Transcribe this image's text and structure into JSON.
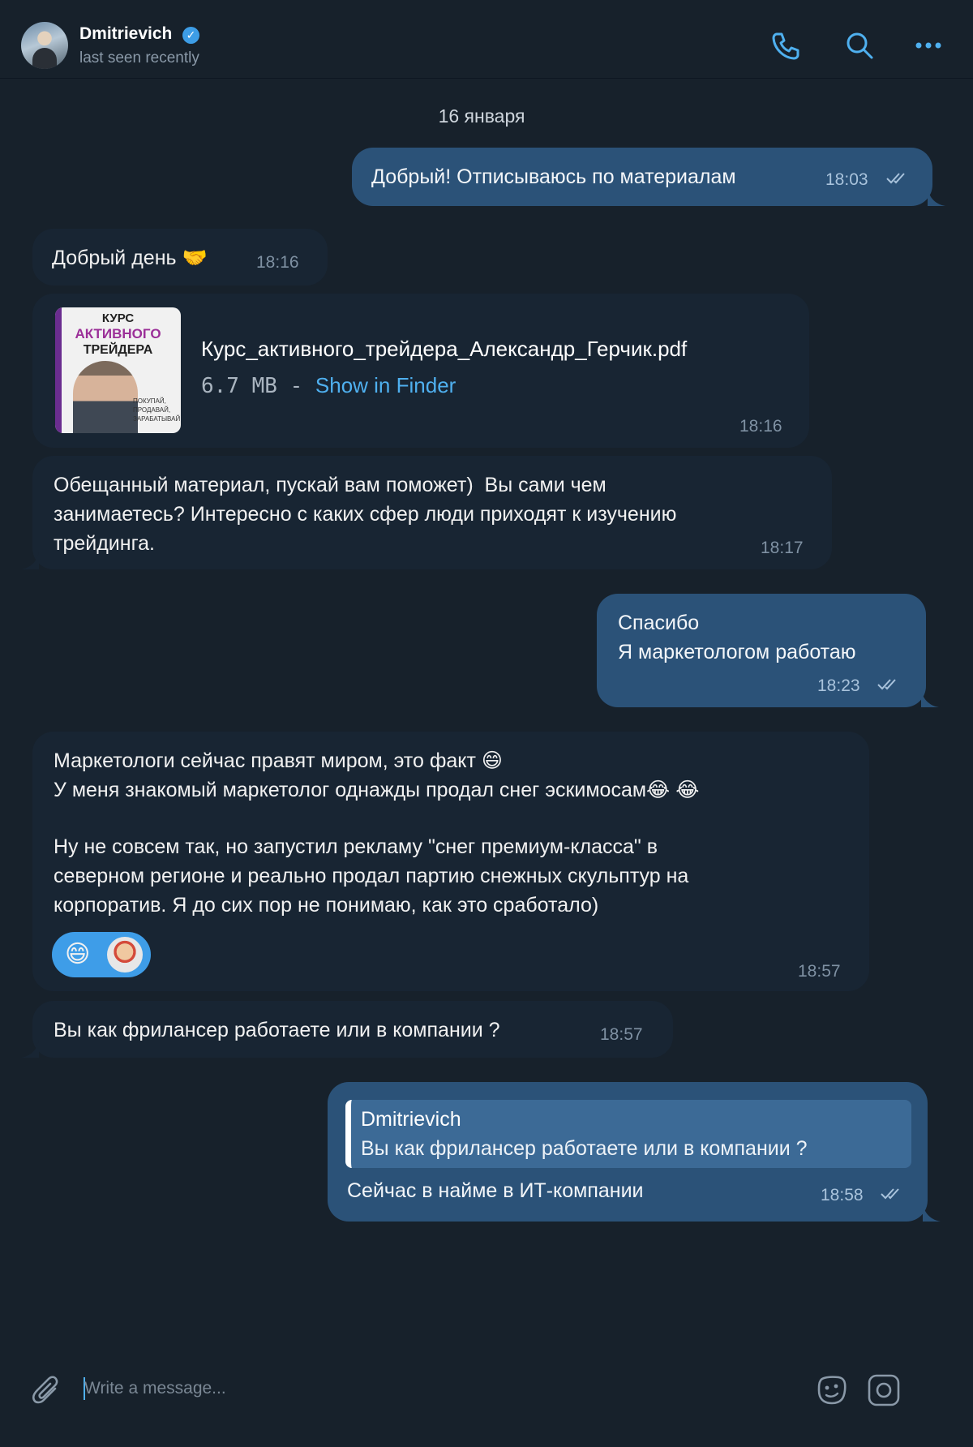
{
  "header": {
    "name": "Dmitrievich",
    "status": "last seen recently",
    "verified_icon": "✓",
    "icons": [
      "phone-icon",
      "search-icon",
      "more-icon"
    ]
  },
  "date_separator": "16 января",
  "messages": [
    {
      "side": "out",
      "text": "Добрый! Отписываюсь по материалам",
      "time": "18:03"
    },
    {
      "side": "in",
      "text": "Добрый день 🤝",
      "time": "18:16"
    },
    {
      "side": "in",
      "type": "file",
      "file_name": "Курс_активного_трейдера_Александр_Герчик.pdf",
      "size": "6.7 MB -",
      "action": "Show in Finder",
      "time": "18:16",
      "thumb": {
        "line1": "КУРС",
        "line2": "АКТИВНОГО",
        "line3": "ТРЕЙДЕРА",
        "tagline": "ПОКУПАЙ, ПРОДАВАЙ, ЗАРАБАТЫВАЙ"
      }
    },
    {
      "side": "in",
      "lines": [
        "Обещанный материал, пускай вам поможет)  Вы сами чем",
        "занимаетесь? Интересно с каких сфер люди приходят к изучению",
        "трейдинга."
      ],
      "time": "18:17"
    },
    {
      "side": "out",
      "lines": [
        "Спасибо",
        "Я маркетологом работаю"
      ],
      "time": "18:23"
    },
    {
      "side": "in",
      "lines": [
        "Маркетологи сейчас правят миром, это факт 😄",
        "У меня знакомый маркетолог однажды продал снег эскимосам😂 😂",
        "",
        "Ну не совсем так, но запустил рекламу \"снег премиум-класса\" в",
        "северном регионе и реально продал партию снежных скульптур на",
        "корпоратив. Я до сих пор не понимаю, как это сработало)"
      ],
      "time": "18:57",
      "reaction": "😄"
    },
    {
      "side": "in",
      "text": "Вы как фрилансер работаете или в компании ?",
      "time": "18:57"
    },
    {
      "side": "out",
      "reply_name": "Dmitrievich",
      "reply_text": "Вы как фрилансер работаете или в компании ?",
      "text": "Сейчас в найме в ИТ-компании",
      "time": "18:58"
    }
  ],
  "input": {
    "placeholder": "Write a message...",
    "icons": [
      "attach-icon",
      "sticker-icon",
      "camera-icon"
    ]
  },
  "colors": {
    "background": "#17212b",
    "bubble_in": "#182533",
    "bubble_out": "#2b5278",
    "accent": "#4fb0ef"
  }
}
